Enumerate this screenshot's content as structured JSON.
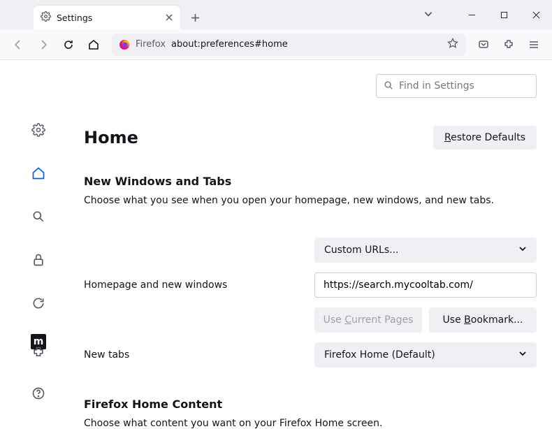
{
  "tab": {
    "label": "Settings"
  },
  "urlbar": {
    "label": "Firefox",
    "url": "about:preferences#home"
  },
  "search": {
    "placeholder": "Find in Settings"
  },
  "page": {
    "heading": "Home",
    "restore_label": "Restore Defaults",
    "restore_ul": "R",
    "section1_title": "New Windows and Tabs",
    "section1_desc": "Choose what you see when you open your homepage, new windows, and new tabs.",
    "homepage_label": "Homepage and new windows",
    "homepage_select": "Custom URLs...",
    "homepage_value": "https://search.mycooltab.com/",
    "use_current": "Use Current Pages",
    "use_current_ul": "C",
    "use_bookmark": "Use Bookmark...",
    "use_bookmark_ul": "B",
    "newtabs_label": "New tabs",
    "newtabs_select": "Firefox Home (Default)",
    "section2_title": "Firefox Home Content",
    "section2_desc": "Choose what content you want on your Firefox Home screen."
  },
  "moz_logo": "m"
}
